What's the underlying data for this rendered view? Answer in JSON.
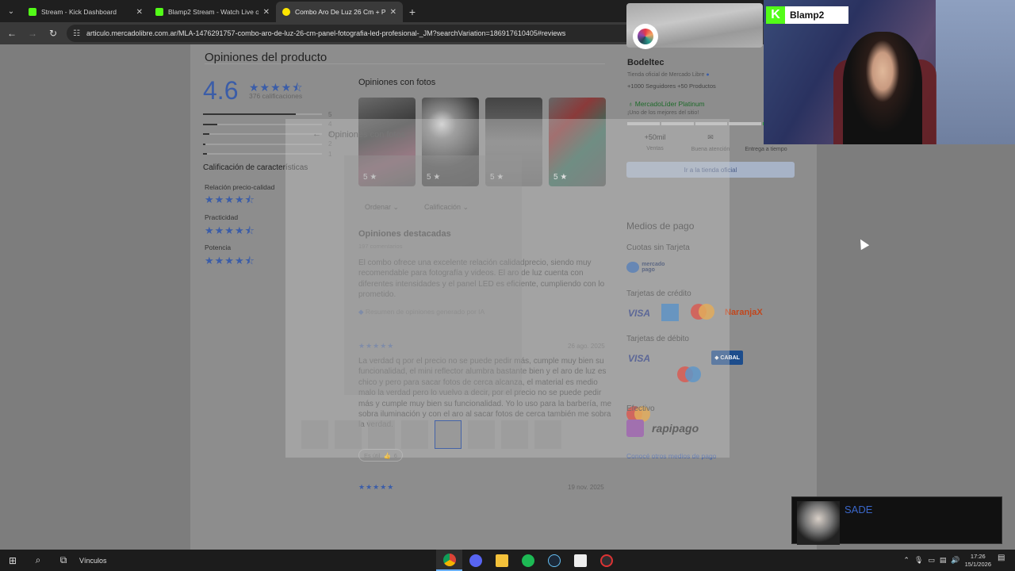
{
  "browser": {
    "tabs": [
      {
        "label": "Stream - Kick Dashboard",
        "active": false
      },
      {
        "label": "Blamp2 Stream - Watch Live on",
        "active": false
      },
      {
        "label": "Combo Aro De Luz 26 Cm + Pa",
        "active": true
      }
    ],
    "url": "articulo.mercadolibre.com.ar/MLA-1476291757-combo-aro-de-luz-26-cm-panel-fotografia-led-profesional-_JM?searchVariation=186917610405#reviews"
  },
  "reviews": {
    "title": "Opiniones del producto",
    "rating": "4.6",
    "rating_stars": "★★★★⯪",
    "count_label": "376 calificaciones",
    "distribution": [
      {
        "star": "5",
        "fraction": 0.78
      },
      {
        "star": "4",
        "fraction": 0.12
      },
      {
        "star": "3",
        "fraction": 0.05
      },
      {
        "star": "2",
        "fraction": 0.02
      },
      {
        "star": "1",
        "fraction": 0.03
      }
    ],
    "characteristics_title": "Calificación de características",
    "characteristics": [
      {
        "label": "Relación precio-calidad",
        "stars": "★★★★⯪"
      },
      {
        "label": "Practicidad",
        "stars": "★★★★⯪"
      },
      {
        "label": "Potencia",
        "stars": "★★★★⯪"
      }
    ],
    "photos_title": "Opiniones con fotos",
    "photos": [
      {
        "rating": "5 ★"
      },
      {
        "rating": "5 ★"
      },
      {
        "rating": "5 ★"
      },
      {
        "rating": "5 ★"
      }
    ],
    "sort_label": "Ordenar",
    "filter_label": "Calificación",
    "featured_title": "Opiniones destacadas",
    "featured_count": "197 comentarios",
    "ai_summary": "El combo ofrece una excelente relación calidadprecio, siendo muy recomendable para fotografía y videos. El aro de luz cuenta con diferentes intensidades y el panel LED es eficiente, cumpliendo con lo prometido.",
    "ai_note": "Resumen de opiniones generado por IA",
    "review1": {
      "stars": "★★★★★",
      "date": "26 ago. 2025",
      "text": "La verdad q por el precio no se puede pedir más, cumple muy bien su funcionalidad, el mini reflector alumbra bastante bien y el aro de luz es chico y pero para sacar fotos de cerca alcanza, el material es medio malo la verdad pero lo vuelvo a decir, por el precio no se puede pedir más y cumple muy bien su funcionalidad. Yo lo uso para la barbería, me sobra iluminación y con el aro al sacar fotos de cerca también me sobra la verdad.",
      "useful_label": "Es útil",
      "useful_count": "6"
    },
    "review2": {
      "stars": "★★★★★",
      "date": "19 nov. 2025"
    },
    "overlay_title": "Opiniones con fotos"
  },
  "seller": {
    "name": "Bodeltec",
    "subtitle": "Tienda oficial de Mercado Libre",
    "stats": "+1000 Seguidores  +50 Productos",
    "badge": "MercadoLíder Platinum",
    "badge_sub": "¡Uno de los mejores del sitio!",
    "sales_value": "+50mil",
    "sales_label": "Ventas",
    "attention_label": "Buena atención",
    "delivery_label": "Entrega a tiempo",
    "store_button": "Ir a la tienda oficial"
  },
  "payment": {
    "title": "Medios de pago",
    "cuotas_title": "Cuotas sin Tarjeta",
    "mp_text": "mercado pago",
    "credit_title": "Tarjetas de crédito",
    "visa": "VISA",
    "naranja": "NaranjaX",
    "debit_title": "Tarjetas de débito",
    "cabal": "◆ CABAL",
    "cash_title": "Efectivo",
    "rapipago": "rapipago",
    "other_link": "Conocé otros medios de pago"
  },
  "stream": {
    "channel": "Blamp2",
    "kick_letter": "K",
    "now_playing_artist": "SADE"
  },
  "taskbar": {
    "search_label": "Vínculos",
    "time": "17:26",
    "date": "15/1/2026"
  }
}
